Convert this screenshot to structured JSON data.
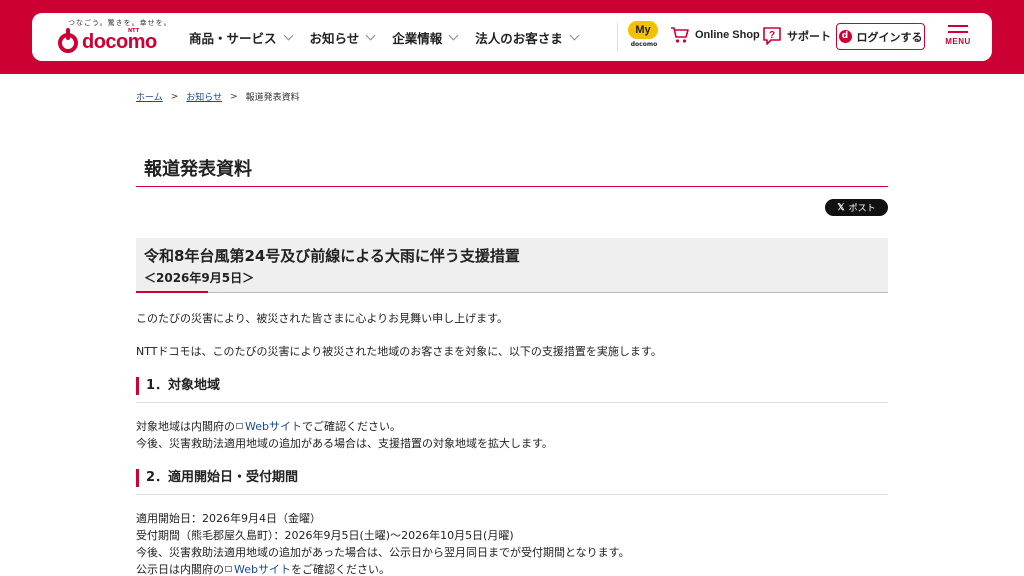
{
  "header": {
    "logo_tagline": "つなごう。驚きを。幸せを。",
    "logo_ntt": "NTT",
    "logo_word": "docomo",
    "nav": [
      {
        "label": "商品・サービス"
      },
      {
        "label": "お知らせ"
      },
      {
        "label": "企業情報"
      },
      {
        "label": "法人のお客さま"
      }
    ],
    "my": "My",
    "my_sub": "docomo",
    "online_shop": "Online Shop",
    "support": "サポート",
    "login": "ログインする",
    "menu": "MENU"
  },
  "breadcrumb": {
    "home": "ホーム",
    "news": "お知らせ",
    "current": "報道発表資料",
    "sep": ">"
  },
  "page_title": "報道発表資料",
  "post_button": {
    "x": "𝕏",
    "label": "ポスト"
  },
  "notice": {
    "title": "令和8年台風第24号及び前線による大雨に伴う支援措置",
    "date": "＜2026年9月5日＞"
  },
  "intro": [
    "このたびの災害により、被災された皆さまに心よりお見舞い申し上げます。",
    "NTTドコモは、このたびの災害により被災された地域のお客さまを対象に、以下の支援措置を実施します。"
  ],
  "section1": {
    "heading": "1．対象地域",
    "line1_pre": "対象地域は内閣府の",
    "line1_link": "Webサイト",
    "line1_post": "でご確認ください。",
    "line2": "今後、災害救助法適用地域の追加がある場合は、支援措置の対象地域を拡大します。"
  },
  "section2": {
    "heading": "2．適用開始日・受付期間",
    "line1": "適用開始日：2026年9月4日（金曜）",
    "line2": "受付期間（熊毛郡屋久島町）：2026年9月5日(土曜)～2026年10月5日(月曜)",
    "line3": "今後、災害救助法適用地域の追加があった場合は、公示日から翌月同日までが受付期間となります。",
    "line4_pre": "公示日は内閣府の",
    "line4_link": "Webサイト",
    "line4_post": "をご確認ください。"
  }
}
